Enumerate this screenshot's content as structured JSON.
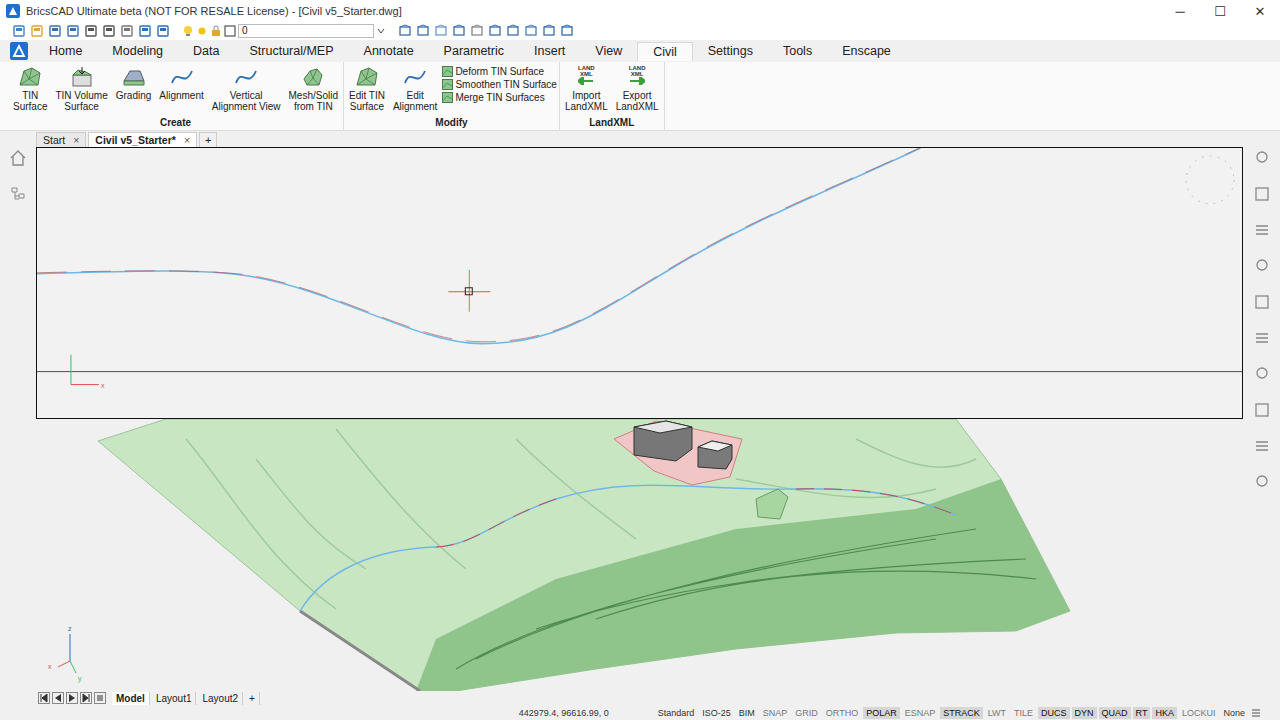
{
  "window": {
    "title": "BricsCAD Ultimate beta (NOT FOR RESALE License) - [Civil v5_Starter.dwg]",
    "controls": [
      "─",
      "☐",
      "✕"
    ]
  },
  "quick_access": {
    "layer": "0"
  },
  "ribbon_tabs": [
    {
      "label": "Home",
      "selected": false
    },
    {
      "label": "Modeling",
      "selected": false
    },
    {
      "label": "Data",
      "selected": false
    },
    {
      "label": "Structural/MEP",
      "selected": false
    },
    {
      "label": "Annotate",
      "selected": false
    },
    {
      "label": "Parametric",
      "selected": false
    },
    {
      "label": "Insert",
      "selected": false
    },
    {
      "label": "View",
      "selected": false
    },
    {
      "label": "Civil",
      "selected": true
    },
    {
      "label": "Settings",
      "selected": false
    },
    {
      "label": "Tools",
      "selected": false
    },
    {
      "label": "Enscape",
      "selected": false
    }
  ],
  "ribbon_groups": [
    {
      "title": "Create",
      "tools": [
        {
          "lines": [
            "TIN",
            "Surface"
          ],
          "kind": "tin"
        },
        {
          "lines": [
            "TIN Volume",
            "Surface"
          ],
          "kind": "volume"
        },
        {
          "lines": [
            "Grading"
          ],
          "kind": "grading"
        },
        {
          "lines": [
            "Alignment"
          ],
          "kind": "curve"
        },
        {
          "lines": [
            "Vertical",
            "Alignment View"
          ],
          "kind": "curve"
        },
        {
          "lines": [
            "Mesh/Solid",
            "from TIN"
          ],
          "kind": "mesh"
        }
      ],
      "small_tools": []
    },
    {
      "title": "Modify",
      "tools": [
        {
          "lines": [
            "Edit TIN",
            "Surface"
          ],
          "kind": "tin"
        },
        {
          "lines": [
            "Edit",
            "Alignment"
          ],
          "kind": "curve"
        }
      ],
      "small_tools": [
        {
          "label": "Deform TIN Surface"
        },
        {
          "label": "Smoothen TIN Surface"
        },
        {
          "label": "Merge TIN Surfaces"
        }
      ]
    },
    {
      "title": "LandXML",
      "tools": [
        {
          "lines": [
            "Import",
            "LandXML"
          ],
          "kind": "import",
          "icon_text": [
            "LAND",
            "XML"
          ]
        },
        {
          "lines": [
            "Export",
            "LandXML"
          ],
          "kind": "export",
          "icon_text": [
            "LAND",
            "XML"
          ]
        }
      ],
      "small_tools": []
    }
  ],
  "document_tabs": [
    {
      "label": "Start",
      "selected": false,
      "close": "×"
    },
    {
      "label": "Civil v5_Starter*",
      "selected": true,
      "close": "×"
    }
  ],
  "new_document": "+",
  "viewports": {
    "top": {
      "axis_labels": [
        "x"
      ]
    },
    "bottom": {
      "axis_labels": [
        "z",
        "x",
        "y"
      ]
    }
  },
  "layout_tabs": [
    {
      "label": "Model",
      "selected": true
    },
    {
      "label": "Layout1",
      "selected": false
    },
    {
      "label": "Layout2",
      "selected": false
    }
  ],
  "new_layout": "+",
  "status_bar": {
    "coordinates": "442979.4, 96616.99, 0",
    "items": [
      {
        "label": "Standard",
        "kind": "text"
      },
      {
        "label": "ISO-25",
        "kind": "text"
      },
      {
        "label": "BIM",
        "kind": "text"
      },
      {
        "label": "SNAP",
        "kind": "toggle",
        "on": false
      },
      {
        "label": "GRID",
        "kind": "toggle",
        "on": false
      },
      {
        "label": "ORTHO",
        "kind": "toggle",
        "on": false
      },
      {
        "label": "POLAR",
        "kind": "toggle",
        "on": true
      },
      {
        "label": "ESNAP",
        "kind": "toggle",
        "on": false
      },
      {
        "label": "STRACK",
        "kind": "toggle",
        "on": true
      },
      {
        "label": "LWT",
        "kind": "toggle",
        "on": false
      },
      {
        "label": "TILE",
        "kind": "toggle",
        "on": false
      },
      {
        "label": "DUCS",
        "kind": "toggle",
        "on": true
      },
      {
        "label": "DYN",
        "kind": "toggle",
        "on": true
      },
      {
        "label": "QUAD",
        "kind": "toggle",
        "on": true
      },
      {
        "label": "RT",
        "kind": "toggle",
        "on": true
      },
      {
        "label": "HKA",
        "kind": "toggle",
        "on": true
      },
      {
        "label": "LOCKUI",
        "kind": "toggle",
        "on": false
      },
      {
        "label": "None",
        "kind": "text"
      }
    ]
  }
}
